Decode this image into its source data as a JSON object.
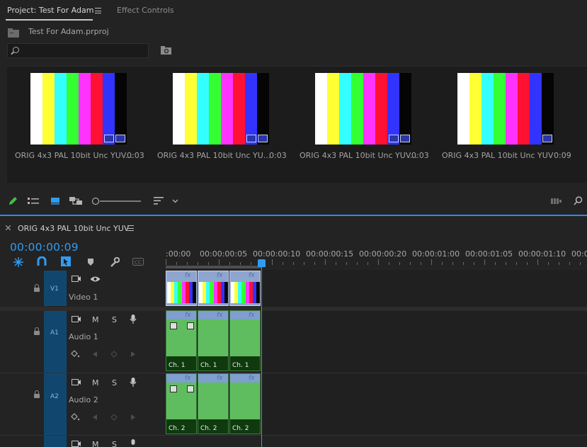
{
  "project_panel": {
    "tabs": [
      {
        "label": "Project: Test For Adam",
        "active": true
      },
      {
        "label": "Effect Controls",
        "active": false
      }
    ],
    "project_file": "Test For Adam.prproj",
    "search": {
      "value": "",
      "placeholder": ""
    },
    "clips": [
      {
        "name": "ORIG 4x3 PAL 10bit Unc YUV...",
        "duration": "0:03"
      },
      {
        "name": "ORIG 4x3 PAL 10bit Unc YU...",
        "duration": "0:03"
      },
      {
        "name": "ORIG 4x3 PAL 10bit Unc YUV...",
        "duration": "0:03"
      },
      {
        "name": "ORIG 4x3 PAL 10bit Unc YUV",
        "duration": "0:09"
      }
    ],
    "bar_colors": [
      "#ffffff",
      "#ffff33",
      "#33ffff",
      "#33ff33",
      "#ff33ff",
      "#ff1133",
      "#3333ff",
      "#050505"
    ]
  },
  "timeline": {
    "sequence_name": "ORIG 4x3 PAL 10bit Unc YUV",
    "timecode": "00:00:00:09",
    "ruler": [
      ":00:00",
      "00:00:00:05",
      "00:00:00:10",
      "00:00:00:15",
      "00:00:00:20",
      "00:00:01:00",
      "00:00:01:05",
      "00:00:01:10",
      "00:00"
    ],
    "tracks": {
      "v1": {
        "patch": "V1",
        "name": "Video 1"
      },
      "a1": {
        "patch": "A1",
        "name": "Audio 1"
      },
      "a2": {
        "patch": "A2",
        "name": "Audio 2"
      }
    },
    "track_buttons": {
      "mute": "M",
      "solo": "S"
    },
    "clip_fx": "fx",
    "audio_labels": {
      "a1": "Ch. 1",
      "a2": "Ch. 2"
    },
    "colors": {
      "accent": "#2f9cf4",
      "patch": "#11476f",
      "audio": "#4ea84e",
      "video": "#8ea5cf"
    }
  },
  "icons": [
    "menu-icon",
    "folder-icon",
    "search-icon",
    "new-bin-icon",
    "pencil-icon",
    "list-view-icon",
    "icon-view-icon",
    "freeform-view-icon",
    "sort-icon",
    "chevron-down-icon",
    "automate-icon",
    "find-icon",
    "close-icon",
    "snap-icon",
    "magnet-icon",
    "linked-selection-icon",
    "marker-icon",
    "wrench-icon",
    "captions-icon",
    "lock-icon",
    "eye-icon",
    "film-icon",
    "mic-icon",
    "keyframe-icon",
    "prev-keyframe-icon",
    "next-keyframe-icon"
  ]
}
